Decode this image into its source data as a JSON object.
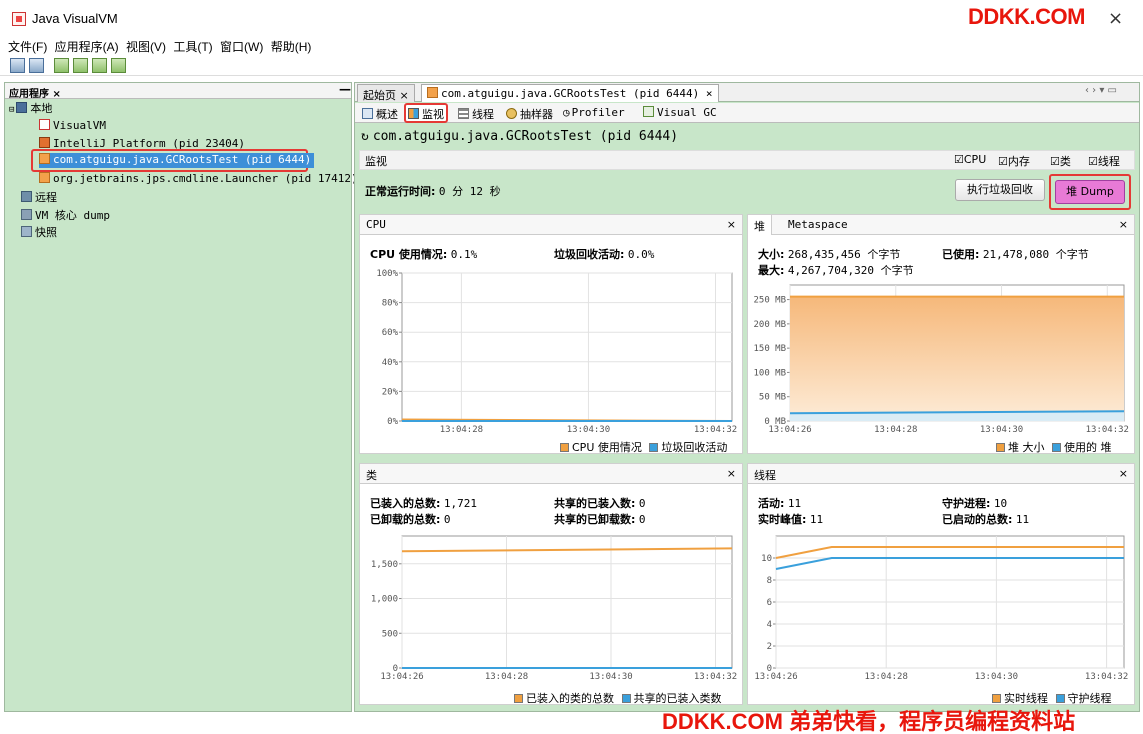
{
  "window": {
    "title": "Java VisualVM",
    "watermark_top": "DDKK.COM",
    "watermark_bottom": "DDKK.COM 弟弟快看，程序员编程资料站"
  },
  "menu": [
    "文件(F)",
    "应用程序(A)",
    "视图(V)",
    "工具(T)",
    "窗口(W)",
    "帮助(H)"
  ],
  "left_panel": {
    "tab": "应用程序 ×",
    "tree": [
      {
        "label": "本地",
        "level": 0,
        "icon": "computer-icon"
      },
      {
        "label": "VisualVM",
        "level": 1,
        "icon": "visualvm-icon"
      },
      {
        "label": "IntelliJ Platform (pid 23404)",
        "level": 1,
        "icon": "intellij-icon"
      },
      {
        "label": "com.atguigu.java.GCRootsTest (pid 6444)",
        "level": 1,
        "icon": "java-icon",
        "selected": true
      },
      {
        "label": "org.jetbrains.jps.cmdline.Launcher (pid 17412)",
        "level": 1,
        "icon": "java-icon"
      },
      {
        "label": "远程",
        "level": 0,
        "icon": "remote-icon"
      },
      {
        "label": "VM 核心 dump",
        "level": 0,
        "icon": "core-dump-icon"
      },
      {
        "label": "快照",
        "level": 0,
        "icon": "snapshot-icon"
      }
    ]
  },
  "doc_tabs": {
    "start": "起始页",
    "process": "com.atguigu.java.GCRootsTest (pid 6444)"
  },
  "sub_tabs": [
    "概述",
    "监视",
    "线程",
    "抽样器",
    "Profiler",
    "Visual GC"
  ],
  "monitor": {
    "process_title": "com.atguigu.java.GCRootsTest (pid 6444)",
    "section_label": "监视",
    "checks": [
      "CPU",
      "内存",
      "类",
      "线程"
    ],
    "uptime_label": "正常运行时间:",
    "uptime_value": "0 分 12 秒",
    "gc_button": "执行垃圾回收",
    "dump_button": "堆 Dump"
  },
  "cpu": {
    "title": "CPU",
    "usage_label": "CPU 使用情况:",
    "usage_value": "0.1%",
    "gc_label": "垃圾回收活动:",
    "gc_value": "0.0%",
    "legend": [
      "CPU 使用情况",
      "垃圾回收活动"
    ]
  },
  "heap": {
    "tab1": "堆",
    "tab2": "Metaspace",
    "size_label": "大小:",
    "size_value": "268,435,456 个字节",
    "used_label": "已使用:",
    "used_value": "21,478,080 个字节",
    "max_label": "最大:",
    "max_value": "4,267,704,320 个字节",
    "legend": [
      "堆 大小",
      "使用的 堆"
    ]
  },
  "classes": {
    "title": "类",
    "loaded_label": "已装入的总数:",
    "loaded_value": "1,721",
    "unloaded_label": "已卸载的总数:",
    "unloaded_value": "0",
    "shared_loaded_label": "共享的已装入数:",
    "shared_loaded_value": "0",
    "shared_unloaded_label": "共享的已卸载数:",
    "shared_unloaded_value": "0",
    "legend": [
      "已装入的类的总数",
      "共享的已装入类数"
    ]
  },
  "threads": {
    "title": "线程",
    "live_label": "活动:",
    "live_value": "11",
    "peak_label": "实时峰值:",
    "peak_value": "11",
    "daemon_label": "守护进程:",
    "daemon_value": "10",
    "started_label": "已启动的总数:",
    "started_value": "11",
    "legend": [
      "实时线程",
      "守护线程"
    ]
  },
  "colors": {
    "orange": "#f0a040",
    "blue": "#3aa0dc",
    "panel_green": "#c8e6c9",
    "selection": "#3d8fd8",
    "highlight_red": "#e53935",
    "dump_pink": "#e87ad6"
  },
  "chart_data": [
    {
      "type": "area",
      "title": "CPU",
      "x": [
        "13:04:26",
        "13:04:33"
      ],
      "x_ticks": [
        "13:04:28",
        "13:04:30",
        "13:04:32"
      ],
      "y_ticks": [
        "0%",
        "20%",
        "40%",
        "60%",
        "80%",
        "100%"
      ],
      "ylim": [
        0,
        100
      ],
      "series": [
        {
          "name": "CPU 使用情况",
          "color": "#f0a040",
          "values": [
            1,
            0
          ]
        },
        {
          "name": "垃圾回收活动",
          "color": "#3aa0dc",
          "values": [
            0,
            0
          ]
        }
      ]
    },
    {
      "type": "area",
      "title": "堆",
      "x": [
        "13:04:26",
        "13:04:33"
      ],
      "x_ticks": [
        "13:04:26",
        "13:04:28",
        "13:04:30",
        "13:04:32"
      ],
      "y_ticks": [
        "0 MB",
        "50 MB",
        "100 MB",
        "150 MB",
        "200 MB",
        "250 MB"
      ],
      "ylim": [
        0,
        280
      ],
      "series": [
        {
          "name": "堆 大小",
          "color": "#f0a040",
          "values": [
            256,
            256
          ]
        },
        {
          "name": "使用的 堆",
          "color": "#3aa0dc",
          "values": [
            16,
            20
          ]
        }
      ]
    },
    {
      "type": "line",
      "title": "类",
      "x": [
        "13:04:26",
        "13:04:33"
      ],
      "x_ticks": [
        "13:04:26",
        "13:04:28",
        "13:04:30",
        "13:04:32"
      ],
      "y_ticks": [
        "0",
        "500",
        "1,000",
        "1,500"
      ],
      "ylim": [
        0,
        1900
      ],
      "series": [
        {
          "name": "已装入的类的总数",
          "color": "#f0a040",
          "values": [
            1680,
            1721
          ]
        },
        {
          "name": "共享的已装入类数",
          "color": "#3aa0dc",
          "values": [
            0,
            0
          ]
        }
      ]
    },
    {
      "type": "line",
      "title": "线程",
      "x": [
        "13:04:26",
        "13:04:33"
      ],
      "x_ticks": [
        "13:04:26",
        "13:04:28",
        "13:04:30",
        "13:04:32"
      ],
      "y_ticks": [
        "0",
        "2",
        "4",
        "6",
        "8",
        "10"
      ],
      "ylim": [
        0,
        12
      ],
      "series": [
        {
          "name": "实时线程",
          "color": "#f0a040",
          "values": [
            10,
            11,
            11
          ]
        },
        {
          "name": "守护线程",
          "color": "#3aa0dc",
          "values": [
            9,
            10,
            10
          ]
        }
      ]
    }
  ]
}
